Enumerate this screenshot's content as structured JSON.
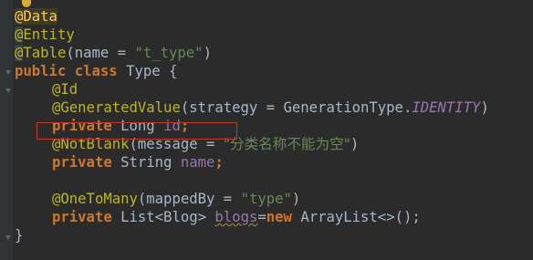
{
  "lines": [
    {
      "at": "@",
      "ann": "Data"
    },
    {
      "at": "@",
      "ann": "Entity"
    },
    {
      "at": "@",
      "ann": "Table",
      "open": "(",
      "param": "name",
      "eq": " = ",
      "str": "\"t_type\"",
      "close": ")"
    },
    {
      "kw1": "public",
      "kw2": "class",
      "name": "Type",
      "brace": " {"
    },
    {
      "at": "@",
      "ann": "Id"
    },
    {
      "at": "@",
      "ann": "GeneratedValue",
      "open": "(",
      "param": "strategy",
      "eq": " = ",
      "enum_type": "GenerationType",
      "dot": ".",
      "enum_val": "IDENTITY",
      "close": ")"
    },
    {
      "kw": "private",
      "type": "Long",
      "field": "id",
      "semi": ";"
    },
    {
      "at": "@",
      "ann": "NotBlank",
      "open": "(",
      "param": "message",
      "eq": " = ",
      "str": "\"分类名称不能为空\"",
      "close": ")"
    },
    {
      "kw": "private",
      "type": "String",
      "field": "name",
      "semi": ";"
    },
    {
      "at": "@",
      "ann": "OneToMany",
      "open": "(",
      "param": "mappedBy",
      "eq": " = ",
      "str": "\"type\"",
      "close": ")"
    },
    {
      "kw": "private",
      "type": "List",
      "generic": "<Blog>",
      "field": "blogs",
      "eq": "=",
      "new": "new",
      "ctor": "ArrayList<>();"
    },
    {
      "brace": "}"
    }
  ],
  "colors": {
    "background": "#2b2b2b",
    "keyword": "#cc7832",
    "annotation": "#bbb529",
    "string": "#6a8759",
    "field": "#9876aa",
    "plain": "#a9b7c6",
    "highlight_box": "#c0392b"
  },
  "icons": {
    "gutter_marker": "lightbulb-icon",
    "fold_marker": "fold-icon"
  }
}
